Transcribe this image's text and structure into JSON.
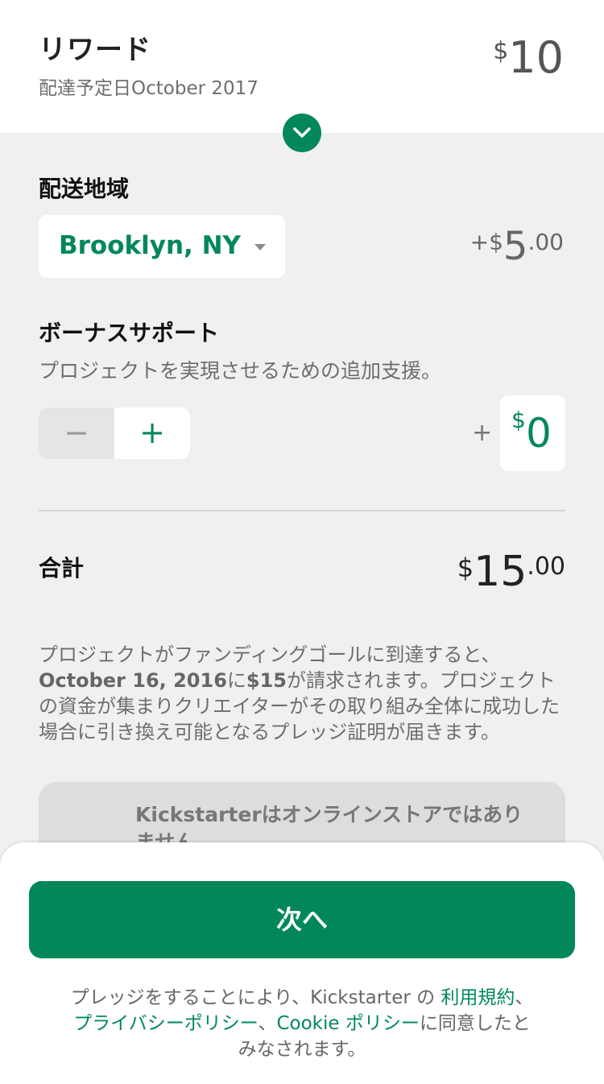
{
  "reward": {
    "title": "リワード",
    "delivery": "配達予定日October 2017",
    "price_currency": "$",
    "price_amount": "10"
  },
  "shipping": {
    "label": "配送地域",
    "location": "Brooklyn, NY",
    "price_prefix": "+",
    "price_currency": "$",
    "price_amount": "5",
    "price_cents": ".00"
  },
  "bonus": {
    "label": "ボーナスサポート",
    "description": "プロジェクトを実現させるための追加支援。",
    "minus": "−",
    "plus": "+",
    "prefix": "+",
    "currency": "$",
    "amount": "0"
  },
  "total": {
    "label": "合計",
    "currency": "$",
    "amount": "15",
    "cents": ".00"
  },
  "info": {
    "line1": "プロジェクトがファンディングゴールに到達すると、",
    "date": "October 16, 2016",
    "mid1": "に",
    "amount": "$15",
    "mid2": "が請求されます。プロジェクトの資金が集まりクリエイターがその取り組み全体に成功した場合に引き換え可能となるプレッジ証明が届きます。"
  },
  "notice": {
    "text": "Kickstarterはオンラインストアではありません"
  },
  "footer": {
    "next_label": "次へ",
    "legal_prefix": "プレッジをすることにより、Kickstarter の ",
    "terms_link": "利用規約",
    "sep1": "、",
    "privacy_link": "プライバシーポリシー",
    "sep2": "、",
    "cookie_link": "Cookie ポリシー",
    "legal_suffix": "に同意したとみなされます。"
  },
  "colors": {
    "accent": "#028858",
    "background": "#f0f0f0"
  }
}
